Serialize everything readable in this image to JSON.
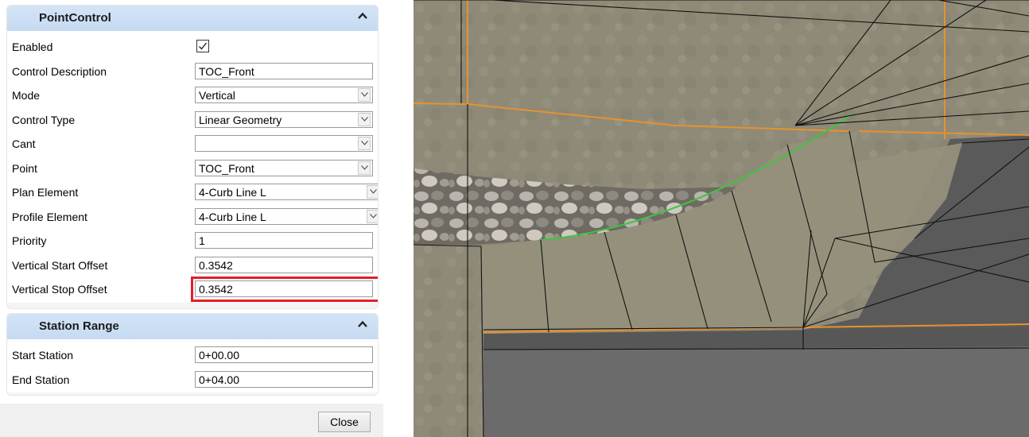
{
  "panel": {
    "section1": {
      "title": "PointControl",
      "rows": [
        {
          "label": "Enabled",
          "type": "checkbox",
          "checked": true
        },
        {
          "label": "Control Description",
          "type": "text",
          "value": "TOC_Front"
        },
        {
          "label": "Mode",
          "type": "combo",
          "value": "Vertical"
        },
        {
          "label": "Control Type",
          "type": "combo",
          "value": "Linear Geometry"
        },
        {
          "label": "Cant",
          "type": "combo",
          "value": ""
        },
        {
          "label": "Point",
          "type": "combo",
          "value": "TOC_Front"
        },
        {
          "label": "Plan Element",
          "type": "combo",
          "value": "4-Curb Line L"
        },
        {
          "label": "Profile Element",
          "type": "combo",
          "value": "4-Curb Line L"
        },
        {
          "label": "Priority",
          "type": "text",
          "value": "1"
        },
        {
          "label": "Vertical Start Offset",
          "type": "text",
          "value": "0.3542"
        },
        {
          "label": "Vertical Stop Offset",
          "type": "text",
          "value": "0.3542",
          "highlighted": true
        }
      ]
    },
    "section2": {
      "title": "Station Range",
      "rows": [
        {
          "label": "Start Station",
          "type": "text",
          "value": "0+00.00"
        },
        {
          "label": "End Station",
          "type": "text",
          "value": "0+04.00"
        }
      ]
    },
    "close_label": "Close"
  },
  "colors": {
    "section_header": "#c9dcf3",
    "highlight": "#e0202a",
    "edge_orange": "#e8912e",
    "edge_green": "#3fc43f"
  }
}
